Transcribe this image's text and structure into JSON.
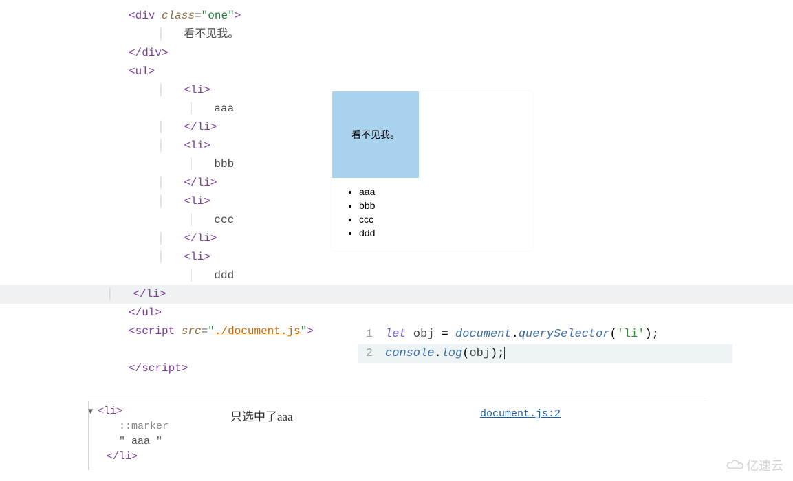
{
  "html_source": {
    "div_class_value": "one",
    "div_text": "看不见我。",
    "script_src": "./document.js",
    "list_items": [
      "aaa",
      "bbb",
      "ccc",
      "ddd"
    ]
  },
  "preview": {
    "box_text": "看不见我。",
    "items": [
      "aaa",
      "bbb",
      "ccc",
      "ddd"
    ]
  },
  "js_editor": {
    "line1": {
      "kw": "let",
      "var": "obj",
      "eq": " = ",
      "obj": "document",
      "fn": "querySelector",
      "arg": "'li'"
    },
    "line2": {
      "obj": "console",
      "fn": "log",
      "arg": "obj"
    },
    "gutter": [
      "1",
      "2"
    ]
  },
  "console_out": {
    "tag_open": "<li>",
    "pseudo": "::marker",
    "text_node": "\" aaa \"",
    "tag_close": "</li>",
    "annotation": "只选中了aaa",
    "link_text": "document.js:2"
  },
  "watermark": "亿速云"
}
